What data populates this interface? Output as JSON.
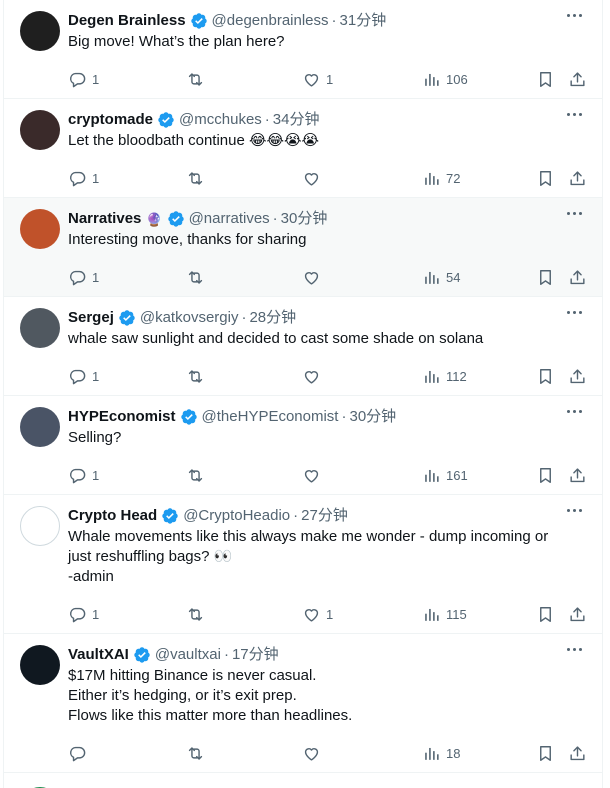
{
  "tweets": [
    {
      "name": "Degen Brainless",
      "handle": "@degenbrainless",
      "time": "31分钟",
      "text": "Big move! What’s the plan here?",
      "replies": "1",
      "retweets": "",
      "likes": "1",
      "views": "106",
      "avatar_color": "#1f1f1f",
      "emoji_badge": ""
    },
    {
      "name": "cryptomade",
      "handle": "@mcchukes",
      "time": "34分钟",
      "text": "Let the bloodbath continue 😂😂😭😭",
      "replies": "1",
      "retweets": "",
      "likes": "",
      "views": "72",
      "avatar_color": "#3a2a2a",
      "emoji_badge": ""
    },
    {
      "name": "Narratives",
      "handle": "@narratives",
      "time": "30分钟",
      "text": "Interesting move, thanks for sharing",
      "replies": "1",
      "retweets": "",
      "likes": "",
      "views": "54",
      "avatar_color": "#c0522a",
      "emoji_badge": "🔮",
      "highlight": true
    },
    {
      "name": "Sergej",
      "handle": "@katkovsergiy",
      "time": "28分钟",
      "text": "whale saw sunlight and decided to cast some shade on solana",
      "replies": "1",
      "retweets": "",
      "likes": "",
      "views": "112",
      "avatar_color": "#505860",
      "emoji_badge": ""
    },
    {
      "name": "HYPEconomist",
      "handle": "@theHYPEconomist",
      "time": "30分钟",
      "text": "Selling?",
      "replies": "1",
      "retweets": "",
      "likes": "",
      "views": "161",
      "avatar_color": "#4a5466",
      "emoji_badge": ""
    },
    {
      "name": "Crypto Head",
      "handle": "@CryptoHeadio",
      "time": "27分钟",
      "text": "Whale movements like this always make me wonder - dump incoming or\njust reshuffling bags? 👀\n-admin",
      "replies": "1",
      "retweets": "",
      "likes": "1",
      "views": "115",
      "avatar_color": "#ffffff",
      "emoji_badge": ""
    },
    {
      "name": "VaultXAI",
      "handle": "@vaultxai",
      "time": "17分钟",
      "text": "$17M hitting Binance is never casual.\nEither it’s hedging, or it’s exit prep.\nFlows like this matter more than headlines.",
      "replies": "",
      "retweets": "",
      "likes": "",
      "views": "18",
      "avatar_color": "#101820",
      "emoji_badge": ""
    }
  ],
  "colors": {
    "verified": "#1d9bf0",
    "muted": "#536471",
    "text": "#0f1419"
  }
}
